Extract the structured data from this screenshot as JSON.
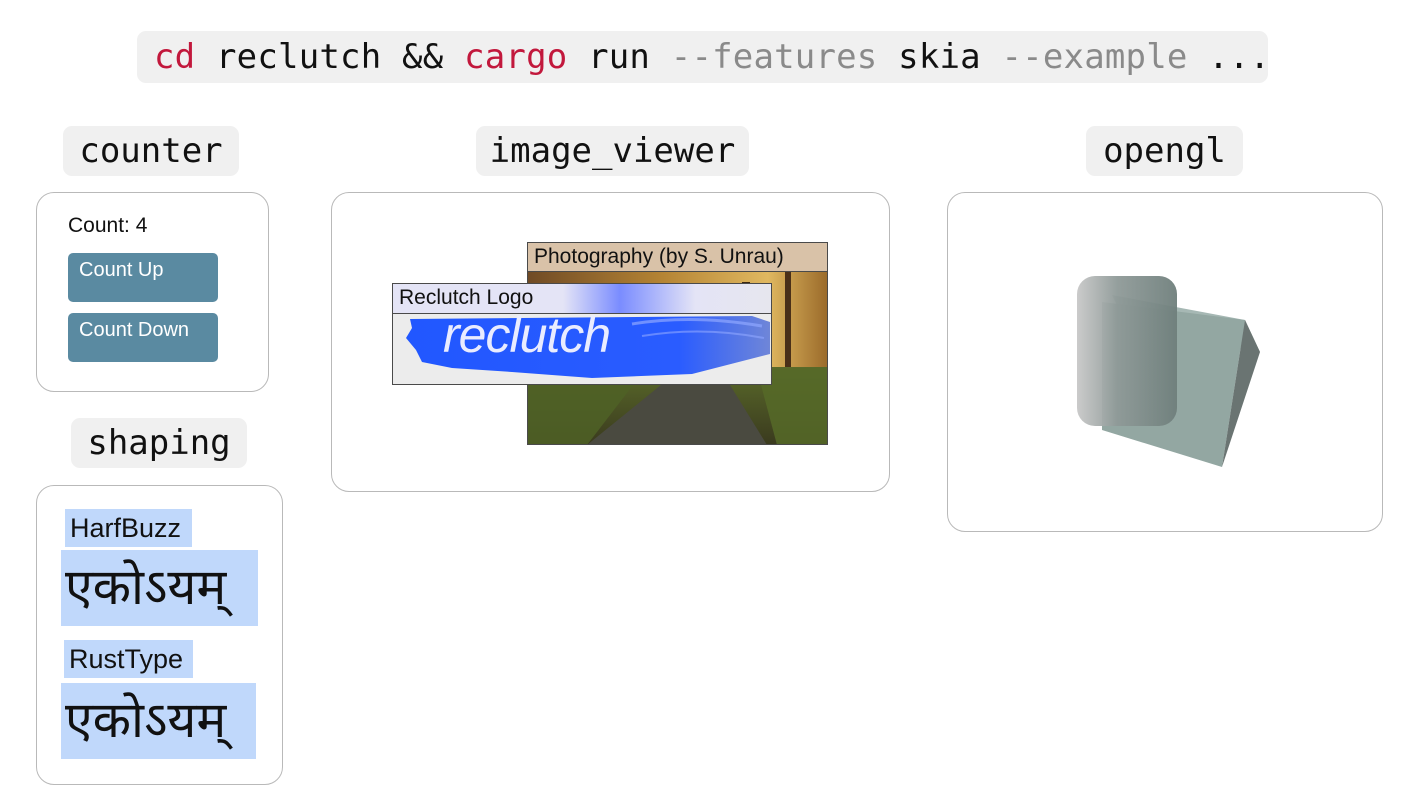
{
  "command": {
    "cd": "cd",
    "dir": "reclutch",
    "and": "&&",
    "cargo": "cargo",
    "run": "run",
    "features_flag": "--features",
    "features_value": "skia",
    "example_flag": "--example",
    "ellipsis": "..."
  },
  "examples": {
    "counter": {
      "tag": "counter",
      "count_label": "Count: 4",
      "count_up_label": "Count Up",
      "count_down_label": "Count Down"
    },
    "image_viewer": {
      "tag": "image_viewer",
      "photo_title": "Photography (by S. Unrau)",
      "logo_title": "Reclutch Logo",
      "logo_text": "reclutch"
    },
    "opengl": {
      "tag": "opengl"
    },
    "shaping": {
      "tag": "shaping",
      "harfbuzz_label": "HarfBuzz",
      "harfbuzz_sample": "एकोऽयम्",
      "rusttype_label": "RustType",
      "rusttype_sample": "एकोऽयम्"
    }
  },
  "colors": {
    "keyword": "#c2183c",
    "flag": "#8a8a8a",
    "button": "#5a8aa1",
    "highlight": "#c0d8fb",
    "logo_blue": "#2157ff"
  }
}
